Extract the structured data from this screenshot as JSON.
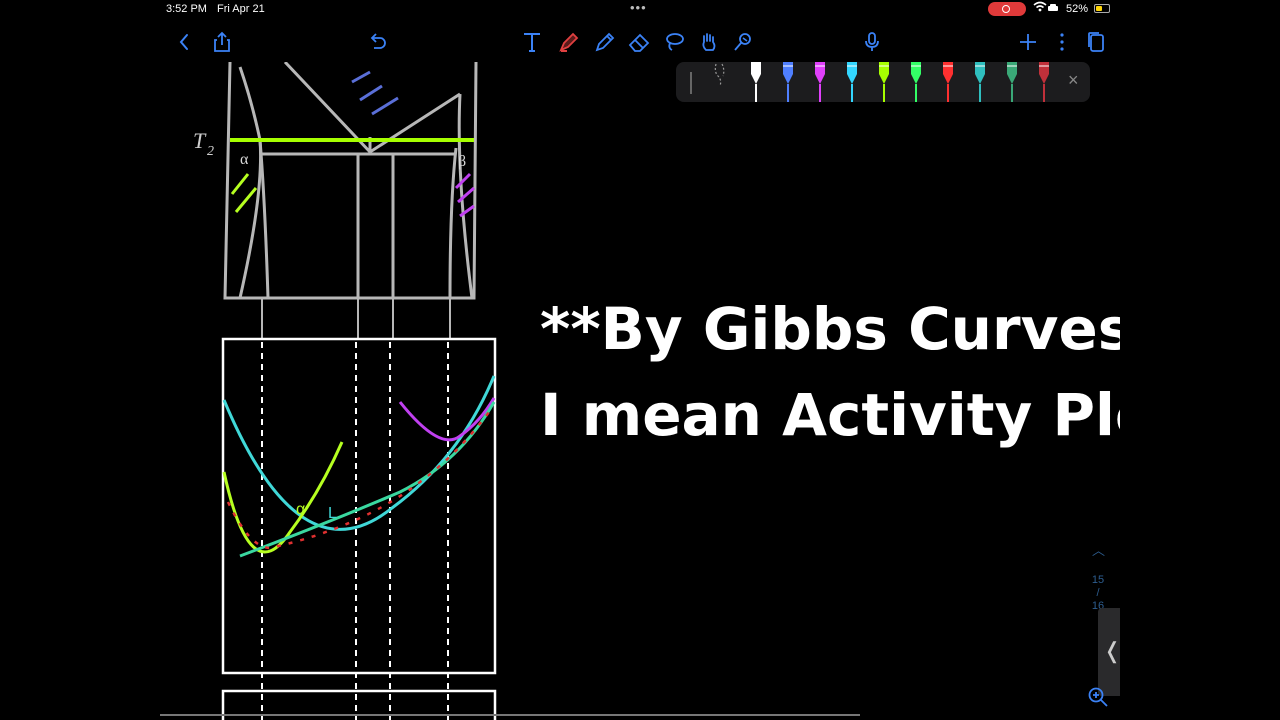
{
  "status_bar": {
    "time": "3:52 PM",
    "date": "Fri Apr 21",
    "battery_percent": "52%",
    "battery_level": 0.52,
    "recording_color": "#e03a3a"
  },
  "toolbar": {
    "left_icons": [
      "back-icon",
      "share-icon",
      "undo-icon"
    ],
    "tool_icons": [
      "text-tool-icon",
      "pen-tool-icon",
      "pencil-tool-icon",
      "eraser-tool-icon",
      "lasso-tool-icon",
      "hand-tool-icon",
      "shape-tool-icon"
    ],
    "right_icons": [
      "microphone-icon",
      "add-icon",
      "more-icon",
      "pages-icon"
    ],
    "accent_color": "#3b82f6"
  },
  "pen_tray": {
    "colors": [
      "#ffffff",
      "#4f7fff",
      "#e040fb",
      "#33d6ff",
      "#a6ff00",
      "#33ff66",
      "#ff3030",
      "#2fbfbf",
      "#3aa877",
      "#c0303a"
    ],
    "close_glyph": "×"
  },
  "caption": {
    "line1": "**By Gibbs Curves",
    "line2": "I mean Activity Plots**"
  },
  "diagram": {
    "label_t2": "T",
    "label_t2_sub": "2",
    "label_alpha": "α",
    "label_beta": "β"
  },
  "page_nav": {
    "current": "15",
    "separator": "/",
    "total": "16"
  },
  "side_tab_glyph": "❬"
}
